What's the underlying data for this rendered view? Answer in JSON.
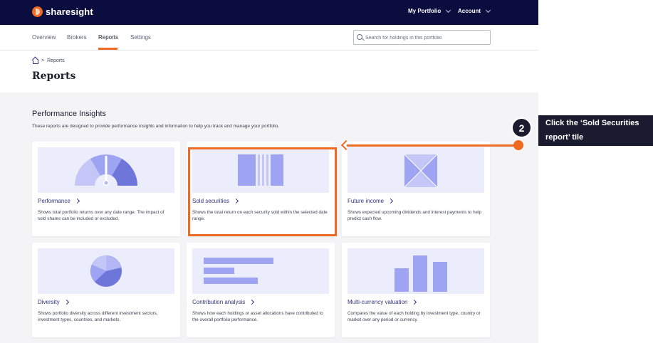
{
  "topbar": {
    "brand": "sharesight",
    "my_portfolio": "My Portfolio",
    "account": "Account"
  },
  "subnav": {
    "tabs": [
      {
        "label": "Overview"
      },
      {
        "label": "Brokers"
      },
      {
        "label": "Reports",
        "active": true
      },
      {
        "label": "Settings"
      }
    ],
    "search_placeholder": "Search for holdings in this portfolio"
  },
  "breadcrumb": {
    "separator": ">",
    "current": "Reports"
  },
  "page_title": "Reports",
  "section": {
    "title": "Performance Insights",
    "description": "These reports are designed to provide performance insights and information to help you track and manage your portfolio."
  },
  "cards": [
    {
      "title": "Performance",
      "description": "Shows total portfolio returns over any date range. The impact of sold shares can be included or excluded.",
      "icon": "gauge-icon"
    },
    {
      "title": "Sold securities",
      "description": "Shows the total return on each security sold within the selected date range.",
      "icon": "bars-icon"
    },
    {
      "title": "Future income",
      "description": "Shows expected upcoming dividends and interest payments to help predict cash flow.",
      "icon": "envelope-icon"
    },
    {
      "title": "Diversity",
      "description": "Shows portfolio diversity across different investment sectors, investment types, countries, and markets.",
      "icon": "pie-icon"
    },
    {
      "title": "Contribution analysis",
      "description": "Shows how each holdings or asset allocations have contributed to the overall portfolio performance.",
      "icon": "horizontal-bars-icon"
    },
    {
      "title": "Multi-currency valuation",
      "description": "Compares the value of each holding by investment type, country or market over any period or currency.",
      "icon": "column-chart-icon"
    }
  ],
  "annotation": {
    "step": "2",
    "text": "Click the ‘Sold Securities report’ tile"
  },
  "colors": {
    "navbar": "#0b0d3f",
    "accent": "#f06a23",
    "link": "#2f3280",
    "illustration_bg": "#ecedfc",
    "illustration_light": "#c3c6f7",
    "illustration_mid": "#9ea3f2",
    "illustration_dark": "#6f76d9"
  }
}
